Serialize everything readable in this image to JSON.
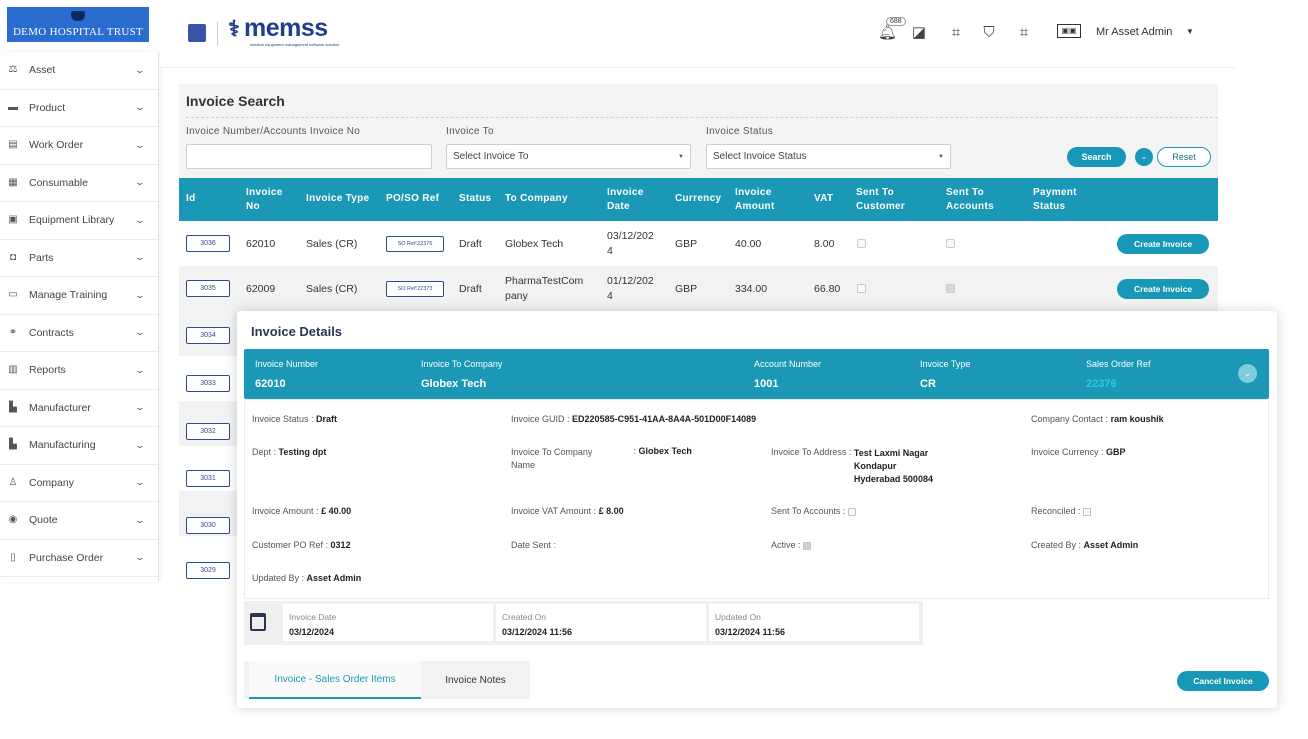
{
  "org_logo_text": "DEMO HOSPITAL TRUST",
  "sidebar": {
    "items": [
      {
        "label": "Asset",
        "icon": "asset-icon"
      },
      {
        "label": "Product",
        "icon": "product-icon"
      },
      {
        "label": "Work Order",
        "icon": "work-order-icon"
      },
      {
        "label": "Consumable",
        "icon": "consumable-icon"
      },
      {
        "label": "Equipment Library",
        "icon": "equipment-library-icon"
      },
      {
        "label": "Parts",
        "icon": "parts-icon"
      },
      {
        "label": "Manage Training",
        "icon": "training-icon"
      },
      {
        "label": "Contracts",
        "icon": "contracts-icon"
      },
      {
        "label": "Reports",
        "icon": "reports-icon"
      },
      {
        "label": "Manufacturer",
        "icon": "manufacturer-icon"
      },
      {
        "label": "Manufacturing",
        "icon": "manufacturing-icon"
      },
      {
        "label": "Company",
        "icon": "company-icon"
      },
      {
        "label": "Quote",
        "icon": "quote-icon"
      },
      {
        "label": "Purchase Order",
        "icon": "purchase-order-icon"
      }
    ]
  },
  "header": {
    "brand": "memss",
    "brand_tagline": "medical equipment management software solution",
    "notification_count": "688",
    "user_name": "Mr Asset Admin"
  },
  "search": {
    "title": "Invoice Search",
    "invoice_number_label": "Invoice Number/Accounts Invoice No",
    "invoice_number_value": "",
    "invoice_to_label": "Invoice To",
    "invoice_to_value": "Select Invoice To",
    "invoice_status_label": "Invoice Status",
    "invoice_status_value": "Select Invoice Status",
    "search_label": "Search",
    "reset_label": "Reset"
  },
  "table": {
    "headers": {
      "id": "Id",
      "invoice_no": "Invoice\nNo",
      "invoice_type": "Invoice Type",
      "po_so_ref": "PO/SO Ref",
      "status": "Status",
      "to_company": "To Company",
      "invoice_date": "Invoice\nDate",
      "currency": "Currency",
      "invoice_amount": "Invoice\nAmount",
      "vat": "VAT",
      "sent_to_customer": "Sent To\nCustomer",
      "sent_to_accounts": "Sent To\nAccounts",
      "payment_status": "Payment\nStatus"
    },
    "rows": [
      {
        "id": "3036",
        "invoice_no": "62010",
        "invoice_type": "Sales (CR)",
        "po_so_ref": "SO Ref:22376",
        "status": "Draft",
        "to_company": "Globex Tech",
        "invoice_date": "03/12/202\n4",
        "currency": "GBP",
        "invoice_amount": "40.00",
        "vat": "8.00",
        "action": "Create Invoice"
      },
      {
        "id": "3035",
        "invoice_no": "62009",
        "invoice_type": "Sales (CR)",
        "po_so_ref": "SO Ref:22373",
        "status": "Draft",
        "to_company": "PharmaTestCom\npany",
        "invoice_date": "01/12/202\n4",
        "currency": "GBP",
        "invoice_amount": "334.00",
        "vat": "66.80",
        "action": "Create Invoice"
      }
    ],
    "more_ids": [
      "3034",
      "3033",
      "3032",
      "3031",
      "3030",
      "3029"
    ]
  },
  "details": {
    "title": "Invoice Details",
    "band": {
      "invoice_number_label": "Invoice Number",
      "invoice_number": "62010",
      "invoice_to_company_label": "Invoice To Company",
      "invoice_to_company": "Globex Tech",
      "account_number_label": "Account Number",
      "account_number": "1001",
      "invoice_type_label": "Invoice Type",
      "invoice_type": "CR",
      "sales_order_ref_label": "Sales Order Ref",
      "sales_order_ref": "22376"
    },
    "invoice_status_label": "Invoice Status",
    "invoice_status": "Draft",
    "invoice_guid_label": "Invoice GUID",
    "invoice_guid": "ED220585-C951-41AA-8A4A-501D00F14089",
    "company_contact_label": "Company Contact",
    "company_contact": "ram koushik",
    "dept_label": "Dept",
    "dept": "Testing dpt",
    "invoice_to_company_name_label": "Invoice To Company\nName",
    "invoice_to_company_name": "Globex Tech",
    "invoice_to_address_label": "Invoice To Address",
    "invoice_to_address": "Test Laxmi Nagar\nKondapur\nHyderabad 500084",
    "invoice_currency_label": "Invoice Currency",
    "invoice_currency": "GBP",
    "invoice_amount_label": "Invoice Amount",
    "invoice_amount": "£ 40.00",
    "invoice_vat_amount_label": "Invoice VAT Amount",
    "invoice_vat_amount": "£ 8.00",
    "sent_to_accounts_label": "Sent To Accounts",
    "reconciled_label": "Reconciled",
    "customer_po_ref_label": "Customer PO Ref",
    "customer_po_ref": "0312",
    "date_sent_label": "Date Sent",
    "active_label": "Active",
    "created_by_label": "Created By",
    "created_by": "Asset Admin",
    "updated_by_label": "Updated By",
    "updated_by": "Asset Admin",
    "invoice_date_label": "Invoice Date",
    "invoice_date": "03/12/2024",
    "created_on_label": "Created On",
    "created_on": "03/12/2024 11:56",
    "updated_on_label": "Updated On",
    "updated_on": "03/12/2024 11:56",
    "tab_items": "Invoice - Sales Order Items",
    "tab_notes": "Invoice Notes",
    "cancel_label": "Cancel Invoice"
  },
  "colors": {
    "accent": "#1a98b6",
    "brand_navy": "#1e3f8f",
    "logo_blue": "#2a6cd0"
  }
}
